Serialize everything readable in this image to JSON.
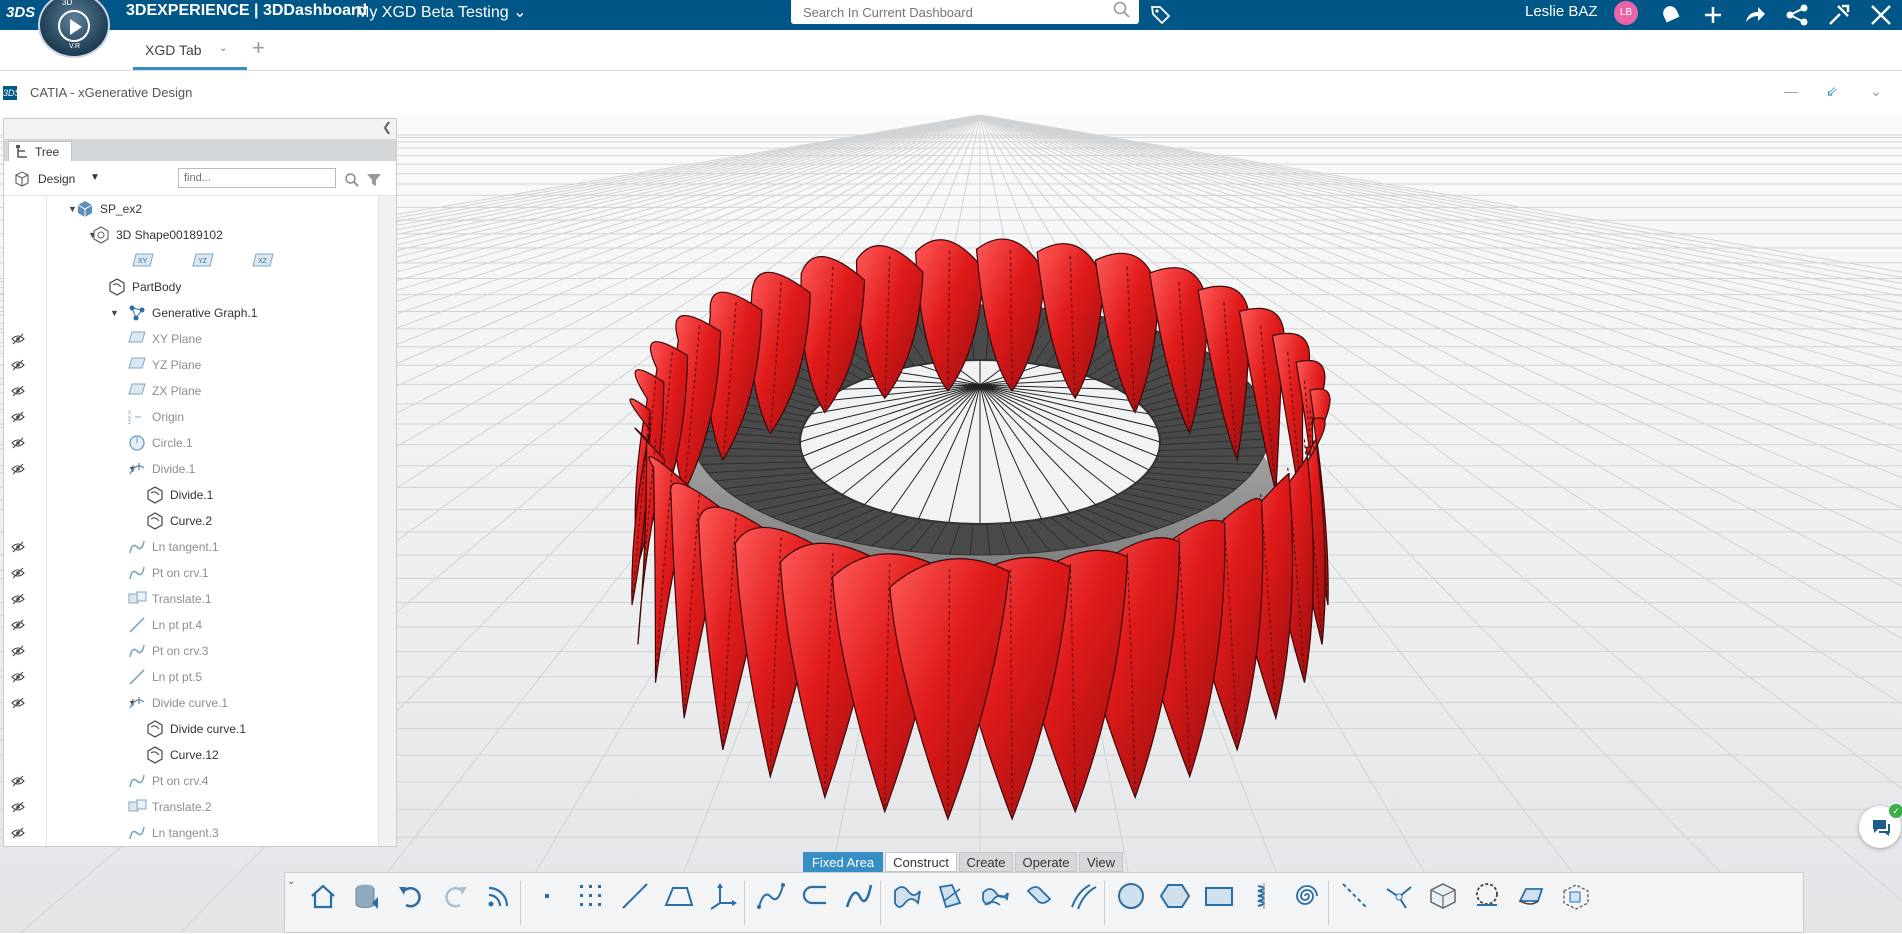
{
  "topbar": {
    "brand": "3DEXPERIENCE | 3DDashboard",
    "dashboard_title": "My XGD Beta Testing",
    "search_placeholder": "Search In Current Dashboard",
    "user_name": "Leslie BAZ",
    "user_initials": "LB",
    "compass_version": "V.R",
    "compass_label": "3D",
    "logo_text": "3DS"
  },
  "tabs": {
    "active_tab": "XGD Tab"
  },
  "app": {
    "title": "CATIA - xGenerative Design",
    "logo_text": "3DS"
  },
  "tree_panel": {
    "tab_label": "Tree",
    "view_mode": "Design",
    "find_placeholder": "find..."
  },
  "tree": [
    {
      "label": "SP_ex2",
      "toggle": "▼",
      "icon": "product-icon",
      "eye": false,
      "dim": false
    },
    {
      "label": "3D Shape00189102",
      "toggle": "▼",
      "icon": "shape-icon",
      "eye": false,
      "dim": false
    },
    {
      "label": "",
      "toggle": "",
      "icon": "planes-row",
      "eye": false,
      "dim": false
    },
    {
      "label": "PartBody",
      "toggle": "",
      "icon": "body-icon",
      "eye": false,
      "dim": false
    },
    {
      "label": "Generative Graph.1",
      "toggle": "▼",
      "icon": "graph-icon",
      "eye": false,
      "dim": false
    },
    {
      "label": "XY Plane",
      "toggle": "",
      "icon": "plane-icon",
      "eye": true,
      "dim": true
    },
    {
      "label": "YZ Plane",
      "toggle": "",
      "icon": "plane-icon",
      "eye": true,
      "dim": true
    },
    {
      "label": "ZX Plane",
      "toggle": "",
      "icon": "plane-icon",
      "eye": true,
      "dim": true
    },
    {
      "label": "Origin",
      "toggle": "",
      "icon": "origin-icon",
      "eye": true,
      "dim": true
    },
    {
      "label": "Circle.1",
      "toggle": "",
      "icon": "circle-icon",
      "eye": true,
      "dim": true
    },
    {
      "label": "Divide.1",
      "toggle": "▼",
      "icon": "divide-icon",
      "eye": true,
      "dim": true
    },
    {
      "label": "Divide.1",
      "toggle": "",
      "icon": "body-icon",
      "eye": false,
      "dim": false
    },
    {
      "label": "Curve.2",
      "toggle": "",
      "icon": "body-icon",
      "eye": false,
      "dim": false
    },
    {
      "label": "Ln tangent.1",
      "toggle": "",
      "icon": "curve-icon",
      "eye": true,
      "dim": true
    },
    {
      "label": "Pt on crv.1",
      "toggle": "",
      "icon": "curve-icon",
      "eye": true,
      "dim": true
    },
    {
      "label": "Translate.1",
      "toggle": "",
      "icon": "translate-icon",
      "eye": true,
      "dim": true
    },
    {
      "label": "Ln pt pt.4",
      "toggle": "",
      "icon": "line-icon",
      "eye": true,
      "dim": true
    },
    {
      "label": "Pt on crv.3",
      "toggle": "",
      "icon": "curve-icon",
      "eye": true,
      "dim": true
    },
    {
      "label": "Ln pt pt.5",
      "toggle": "",
      "icon": "line-icon",
      "eye": true,
      "dim": true
    },
    {
      "label": "Divide curve.1",
      "toggle": "▼",
      "icon": "divide-icon",
      "eye": true,
      "dim": true
    },
    {
      "label": "Divide curve.1",
      "toggle": "",
      "icon": "body-icon",
      "eye": false,
      "dim": false
    },
    {
      "label": "Curve.12",
      "toggle": "",
      "icon": "body-icon",
      "eye": false,
      "dim": false
    },
    {
      "label": "Pt on crv.4",
      "toggle": "",
      "icon": "curve-icon",
      "eye": true,
      "dim": true
    },
    {
      "label": "Translate.2",
      "toggle": "",
      "icon": "translate-icon",
      "eye": true,
      "dim": true
    },
    {
      "label": "Ln tangent.3",
      "toggle": "",
      "icon": "curve-icon",
      "eye": true,
      "dim": true
    }
  ],
  "plane_tags": [
    "XY",
    "YZ",
    "XZ"
  ],
  "action_bar": {
    "tabs": [
      "Fixed Area",
      "Construct",
      "Create",
      "Operate",
      "View"
    ],
    "active_tab": "Construct"
  },
  "toolbar_icons": [
    "home-icon",
    "database-icon",
    "undo-icon",
    "redo-icon",
    "feed-icon",
    "point-icon",
    "point-grid-icon",
    "line-icon",
    "plane-icon",
    "axis-icon",
    "spline-icon",
    "connect-curve-icon",
    "sweep-curve-icon",
    "surface-fill-icon",
    "surface-blend-icon",
    "surface-offset-icon",
    "surface-sweep-icon",
    "parallel-curves-icon",
    "circle-icon",
    "hexagon-icon",
    "rectangle-icon",
    "helix-icon",
    "spiral-icon",
    "divide-line-icon",
    "branch-icon",
    "solid-icon",
    "project-icon",
    "extrude-icon",
    "transform-icon"
  ],
  "colors": {
    "topbar": "#005686",
    "accent": "#368ec4",
    "petal": "#e21b1b",
    "ring": "#8f8f8f"
  }
}
